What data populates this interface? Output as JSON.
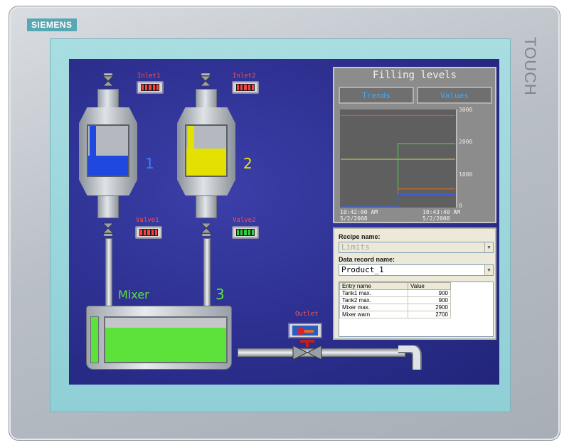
{
  "device": {
    "brand": "SIEMENS",
    "model_text": "TOUCH"
  },
  "process": {
    "inlet1": {
      "label": "Inlet1",
      "state_color": "#ff4040"
    },
    "inlet2": {
      "label": "Inlet2",
      "state_color": "#ff4040"
    },
    "valve1": {
      "label": "Valve1",
      "state_color": "#ff4040"
    },
    "valve2": {
      "label": "Valve2",
      "state_color": "#30d040"
    },
    "tank1": {
      "number": "1",
      "fill_fraction": 0.4,
      "fill_color": "#1f48e0",
      "number_color": "#3a7bff"
    },
    "tank2": {
      "number": "2",
      "fill_fraction": 0.55,
      "fill_color": "#e4e000",
      "number_color": "#f4e600"
    },
    "mixer": {
      "label": "Mixer",
      "number": "3",
      "fill_fraction": 0.78,
      "label_color": "#5ce23a"
    },
    "outlet": {
      "label": "Outlet"
    }
  },
  "trend": {
    "title": "Filling levels",
    "tabs": [
      "Trends",
      "Values"
    ],
    "y_ticks": [
      "3000",
      "2000",
      "1000",
      "0"
    ],
    "x_start": {
      "time": "10:42:00 AM",
      "date": "5/2/2008"
    },
    "x_end": {
      "time": "10:43:40 AM",
      "date": "5/2/2008"
    }
  },
  "chart_data": {
    "type": "line",
    "ylim": [
      0,
      3000
    ],
    "x_range_seconds": [
      0,
      100
    ],
    "series": [
      {
        "color": "#e05050",
        "values": [
          [
            0,
            2900
          ],
          [
            100,
            2900
          ]
        ]
      },
      {
        "color": "#d0d060",
        "values": [
          [
            0,
            1500
          ],
          [
            100,
            1500
          ]
        ]
      },
      {
        "color": "#40e040",
        "values": [
          [
            0,
            0
          ],
          [
            50,
            0
          ],
          [
            50,
            2000
          ],
          [
            100,
            2000
          ]
        ]
      },
      {
        "color": "#e07020",
        "values": [
          [
            0,
            0
          ],
          [
            50,
            0
          ],
          [
            50,
            550
          ],
          [
            100,
            550
          ]
        ]
      },
      {
        "color": "#3060ff",
        "values": [
          [
            0,
            0
          ],
          [
            50,
            0
          ],
          [
            50,
            370
          ],
          [
            100,
            370
          ]
        ]
      }
    ]
  },
  "recipe": {
    "recipe_name_label": "Recipe name:",
    "recipe_name_value": "Limits",
    "record_name_label": "Data record name:",
    "record_name_value": "Product_1",
    "columns": [
      "Entry name",
      "Value"
    ],
    "rows": [
      {
        "name": "Tank1 max.",
        "value": "900"
      },
      {
        "name": "Tank2 max.",
        "value": "900"
      },
      {
        "name": "Mixer max.",
        "value": "2900"
      },
      {
        "name": "Mixer warn",
        "value": "2700"
      }
    ]
  }
}
